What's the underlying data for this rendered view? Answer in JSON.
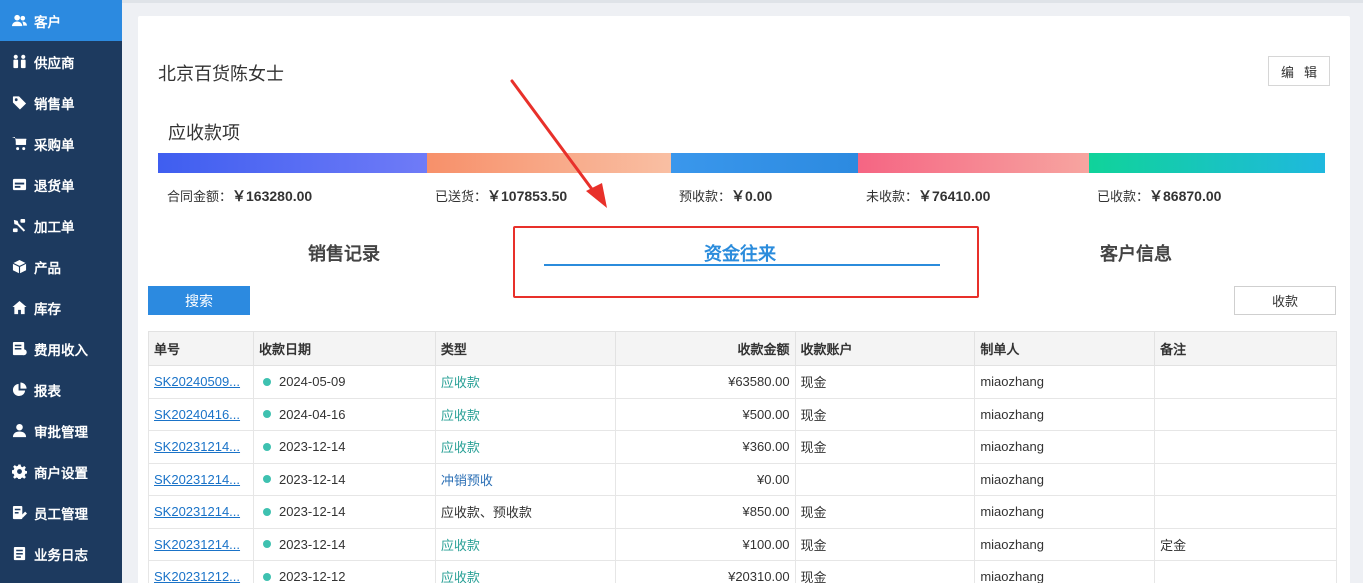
{
  "sidebar": {
    "items": [
      {
        "label": "客户",
        "icon": "users-icon",
        "active": true
      },
      {
        "label": "供应商",
        "icon": "supplier-icon"
      },
      {
        "label": "销售单",
        "icon": "tag-icon"
      },
      {
        "label": "采购单",
        "icon": "cart-icon"
      },
      {
        "label": "退货单",
        "icon": "return-icon"
      },
      {
        "label": "加工单",
        "icon": "tool-icon"
      },
      {
        "label": "产品",
        "icon": "box-icon"
      },
      {
        "label": "库存",
        "icon": "home-icon"
      },
      {
        "label": "费用收入",
        "icon": "ledger-icon"
      },
      {
        "label": "报表",
        "icon": "pie-chart-icon"
      },
      {
        "label": "审批管理",
        "icon": "user-icon"
      },
      {
        "label": "商户设置",
        "icon": "gear-icon"
      },
      {
        "label": "员工管理",
        "icon": "employee-icon"
      },
      {
        "label": "业务日志",
        "icon": "log-icon"
      }
    ]
  },
  "customer": {
    "name": "北京百货陈女士",
    "edit_label": "编辑"
  },
  "receivables": {
    "title": "应收款项",
    "colors": {
      "contract": [
        "#3f5ef0",
        "#6f7bf7"
      ],
      "shipped": [
        "#f7906a",
        "#f9bfa3"
      ],
      "prepaid": [
        "#3a97ec",
        "#2c8ae0"
      ],
      "unpaid": [
        "#f56583",
        "#f7a5a0"
      ],
      "paid": [
        "#10d39a",
        "#1fb8de"
      ]
    },
    "amounts": [
      {
        "label": "合同金额：",
        "value": "￥163280.00"
      },
      {
        "label": "已送货：",
        "value": "￥107853.50"
      },
      {
        "label": "预收款：",
        "value": "￥0.00"
      },
      {
        "label": "未收款：",
        "value": "￥76410.00"
      },
      {
        "label": "已收款：",
        "value": "￥86870.00"
      }
    ]
  },
  "tabs": [
    {
      "label": "销售记录",
      "active": false
    },
    {
      "label": "资金往来",
      "active": true
    },
    {
      "label": "客户信息",
      "active": false
    }
  ],
  "actions": {
    "search_label": "搜索",
    "collect_label": "收款"
  },
  "table": {
    "headers": [
      "单号",
      "收款日期",
      "类型",
      "收款金额",
      "收款账户",
      "制单人",
      "备注"
    ],
    "rows": [
      {
        "id": "SK20240509...",
        "date": "2024-05-09",
        "type": "应收款",
        "amount": "¥63580.00",
        "account": "现金",
        "maker": "miaozhang",
        "note": ""
      },
      {
        "id": "SK20240416...",
        "date": "2024-04-16",
        "type": "应收款",
        "amount": "¥500.00",
        "account": "现金",
        "maker": "miaozhang",
        "note": ""
      },
      {
        "id": "SK20231214...",
        "date": "2023-12-14",
        "type": "应收款",
        "amount": "¥360.00",
        "account": "现金",
        "maker": "miaozhang",
        "note": ""
      },
      {
        "id": "SK20231214...",
        "date": "2023-12-14",
        "type": "冲销预收",
        "amount": "¥0.00",
        "account": "",
        "maker": "miaozhang",
        "note": ""
      },
      {
        "id": "SK20231214...",
        "date": "2023-12-14",
        "type": "应收款、预收款",
        "amount": "¥850.00",
        "account": "现金",
        "maker": "miaozhang",
        "note": ""
      },
      {
        "id": "SK20231214...",
        "date": "2023-12-14",
        "type": "应收款",
        "amount": "¥100.00",
        "account": "现金",
        "maker": "miaozhang",
        "note": "定金"
      },
      {
        "id": "SK20231212...",
        "date": "2023-12-12",
        "type": "应收款",
        "amount": "¥20310.00",
        "account": "现金",
        "maker": "miaozhang",
        "note": ""
      }
    ]
  },
  "annotation_color": "#e8302a"
}
